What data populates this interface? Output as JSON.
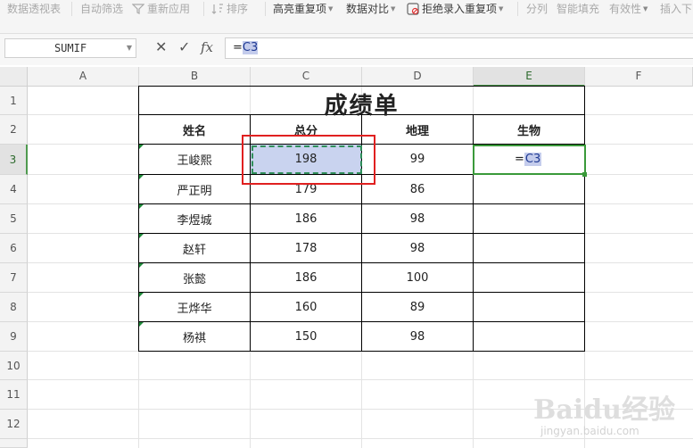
{
  "ribbon": {
    "items": [
      {
        "label": "数据透视表",
        "dim": true
      },
      {
        "label": "自动筛选",
        "dim": true
      },
      {
        "label": "重新应用",
        "dim": true
      },
      {
        "label": "排序",
        "dim": true
      },
      {
        "label": "高亮重复项",
        "dim": false
      },
      {
        "label": "数据对比",
        "dim": false
      },
      {
        "label": "拒绝录入重复项",
        "dim": false
      },
      {
        "label": "分列",
        "dim": true
      },
      {
        "label": "智能填充",
        "dim": true
      },
      {
        "label": "有效性",
        "dim": true
      },
      {
        "label": "插入下",
        "dim": true
      }
    ]
  },
  "formula_bar": {
    "name_box": "SUMIF",
    "cancel_icon": "✕",
    "confirm_icon": "✓",
    "fx_label": "fx",
    "prefix": "=",
    "ref": "C3"
  },
  "columns": [
    "A",
    "B",
    "C",
    "D",
    "E",
    "F"
  ],
  "rows": [
    "1",
    "2",
    "3",
    "4",
    "5",
    "6",
    "7",
    "8",
    "9",
    "10",
    "11",
    "12"
  ],
  "sheet": {
    "title": "成绩单",
    "headers": [
      "姓名",
      "总分",
      "地理",
      "生物"
    ],
    "records": [
      {
        "name": "王峻熙",
        "total": "198",
        "geo": "99"
      },
      {
        "name": "严正明",
        "total": "179",
        "geo": "86"
      },
      {
        "name": "李煜城",
        "total": "186",
        "geo": "98"
      },
      {
        "name": "赵轩",
        "total": "178",
        "geo": "98"
      },
      {
        "name": "张懿",
        "total": "186",
        "geo": "100"
      },
      {
        "name": "王烨华",
        "total": "160",
        "geo": "89"
      },
      {
        "name": "杨祺",
        "total": "150",
        "geo": "98"
      }
    ],
    "editing_cell": {
      "prefix": "=",
      "ref": "C3"
    }
  },
  "watermark": {
    "main": "Baidu经验",
    "sub": "jingyan.baidu.com"
  },
  "colors": {
    "selection_green": "#3a9a3a",
    "reference_blue": "#c4ccec",
    "highlight_red": "#e02020"
  }
}
